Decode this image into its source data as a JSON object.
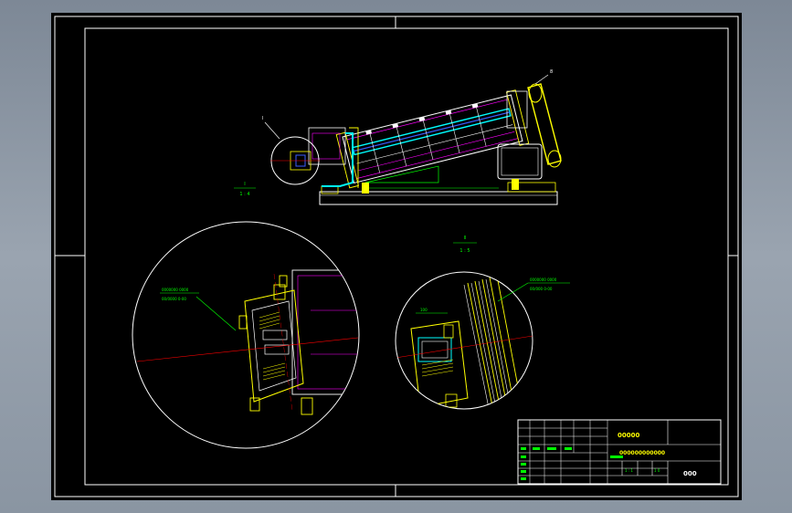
{
  "colors": {
    "background": "#8d97a3",
    "paper": "#000000",
    "frame": "#ffffff",
    "annotation": "#00ff00",
    "accent_yellow": "#ffff00",
    "accent_cyan": "#00ffff",
    "accent_magenta": "#ff00ff",
    "accent_red": "#ff0000",
    "accent_blue": "#3a5bff"
  },
  "view_labels": {
    "main_view_callout": "I",
    "detail_a_callout": "II",
    "detail_a_letter": "I",
    "detail_a_scale": "1 : 4",
    "detail_b_letter": "II",
    "detail_b_scale": "1 : 5"
  },
  "detail_a_note": {
    "line1": "0000000 0000",
    "line2": "00/0000 0-00"
  },
  "detail_b_note": {
    "line1": "0000000 0000",
    "line2": "00/000 0-00",
    "dim": "100"
  },
  "title_block": {
    "org": "00000",
    "drawing_name": "000000000000",
    "drawing_code": "000",
    "scale_row": "1 : 1",
    "sheet_row": "1 0"
  }
}
